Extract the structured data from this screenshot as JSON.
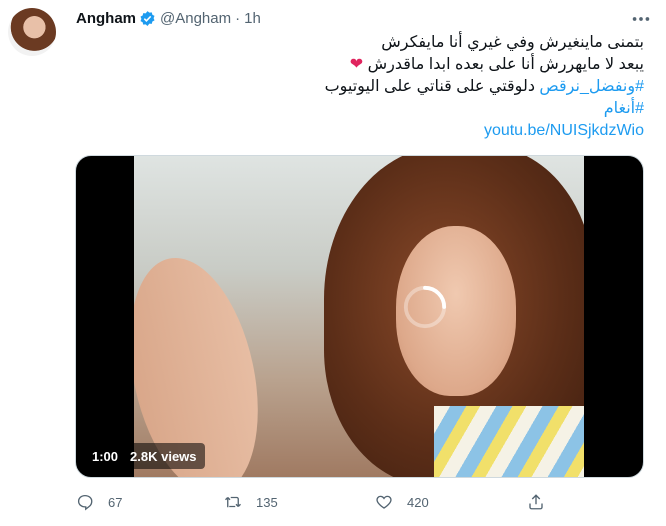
{
  "author": {
    "name": "Angham",
    "handle": "@Angham",
    "time": "1h"
  },
  "tweet": {
    "line1": "بتمنى ماينغيرش وفي غيري أنا مايفكرش",
    "line2": "يبعد لا مايهررش أنا على بعده ابدا ماقدرش",
    "hashtag1": "#ونفضل_نرقص",
    "line3_text": "دلوقتي على قناتي على اليوتيوب",
    "hashtag2": "#أنغام",
    "link": "youtu.be/NUISjkdzWio"
  },
  "media": {
    "duration": "1:00",
    "views": "2.8K views"
  },
  "actions": {
    "replies": "67",
    "retweets": "135",
    "likes": "420"
  },
  "colors": {
    "link": "#1d9bf0",
    "heart": "#e0245e",
    "muted": "#536471"
  },
  "icons": [
    "verified-badge-icon",
    "more-icon",
    "reply-icon",
    "retweet-icon",
    "like-icon",
    "share-icon",
    "heart-emoji-icon",
    "loading-spinner-icon"
  ]
}
